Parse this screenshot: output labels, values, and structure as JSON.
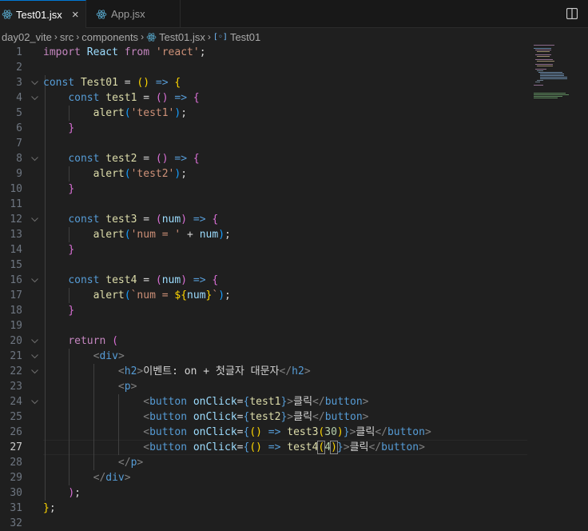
{
  "tabs": [
    {
      "label": "Test01.jsx",
      "close": "×"
    },
    {
      "label": "App.jsx"
    }
  ],
  "breadcrumb": [
    "day02_vite",
    "src",
    "components",
    "Test01.jsx",
    "Test01"
  ],
  "colors": {
    "accent": "#0078d4",
    "react": "#519aba"
  },
  "icons": {
    "react": "react-icon",
    "split": "split-editor-icon",
    "symbol": "symbol-variable-icon"
  },
  "current_line": 27,
  "line_numbers": [
    "1",
    "2",
    "3",
    "4",
    "5",
    "6",
    "7",
    "8",
    "9",
    "10",
    "11",
    "12",
    "13",
    "14",
    "15",
    "16",
    "17",
    "18",
    "19",
    "20",
    "21",
    "22",
    "23",
    "24",
    "25",
    "26",
    "27",
    "28",
    "29",
    "30",
    "31",
    "32"
  ],
  "code": {
    "l1": [
      "import",
      "React",
      "from",
      "'react'",
      ";"
    ],
    "l3": [
      "const",
      "Test01",
      "=",
      "(",
      ")",
      "=>",
      "{"
    ],
    "l4": [
      "const",
      "test1",
      "=",
      "(",
      ")",
      "=>",
      "{"
    ],
    "l5": [
      "alert",
      "(",
      "'test1'",
      ")",
      ";"
    ],
    "l6": [
      "}"
    ],
    "l8": [
      "const",
      "test2",
      "=",
      "(",
      ")",
      "=>",
      "{"
    ],
    "l9": [
      "alert",
      "(",
      "'test2'",
      ")",
      ";"
    ],
    "l10": [
      "}"
    ],
    "l12": [
      "const",
      "test3",
      "=",
      "(",
      "num",
      ")",
      "=>",
      "{"
    ],
    "l13": [
      "alert",
      "(",
      "'num = '",
      "+",
      "num",
      ")",
      ";"
    ],
    "l14": [
      "}"
    ],
    "l16": [
      "const",
      "test4",
      "=",
      "(",
      "num",
      ")",
      "=>",
      "{"
    ],
    "l17": [
      "alert",
      "(",
      "`num = ",
      "${",
      "num",
      "}",
      "`",
      ")",
      ";"
    ],
    "l18": [
      "}"
    ],
    "l20": [
      "return",
      "("
    ],
    "l21": [
      "<",
      "div",
      ">"
    ],
    "l22": [
      "<",
      "h2",
      ">",
      "이벤트: on + 첫글자 대문자",
      "</",
      "h2",
      ">"
    ],
    "l23": [
      "<",
      "p",
      ">"
    ],
    "l24": [
      "<",
      "button",
      "onClick",
      "=",
      "{",
      "test1",
      "}",
      ">",
      "클릭",
      "</",
      "button",
      ">"
    ],
    "l25": [
      "<",
      "button",
      "onClick",
      "=",
      "{",
      "test2",
      "}",
      ">",
      "클릭",
      "</",
      "button",
      ">"
    ],
    "l26": [
      "<",
      "button",
      "onClick",
      "=",
      "{",
      "(",
      ")",
      "=>",
      "test3",
      "(",
      "30",
      ")",
      "}",
      ">",
      "클릭",
      "</",
      "button",
      ">"
    ],
    "l27": [
      "<",
      "button",
      "onClick",
      "=",
      "{",
      "(",
      ")",
      "=>",
      "test4",
      "(",
      "4",
      ")",
      "}",
      ">",
      "클릭",
      "</",
      "button",
      ">"
    ],
    "l28": [
      "</",
      "p",
      ">"
    ],
    "l29": [
      "</",
      "div",
      ">"
    ],
    "l30": [
      ")",
      ";"
    ],
    "l31": [
      "}",
      ";"
    ]
  }
}
